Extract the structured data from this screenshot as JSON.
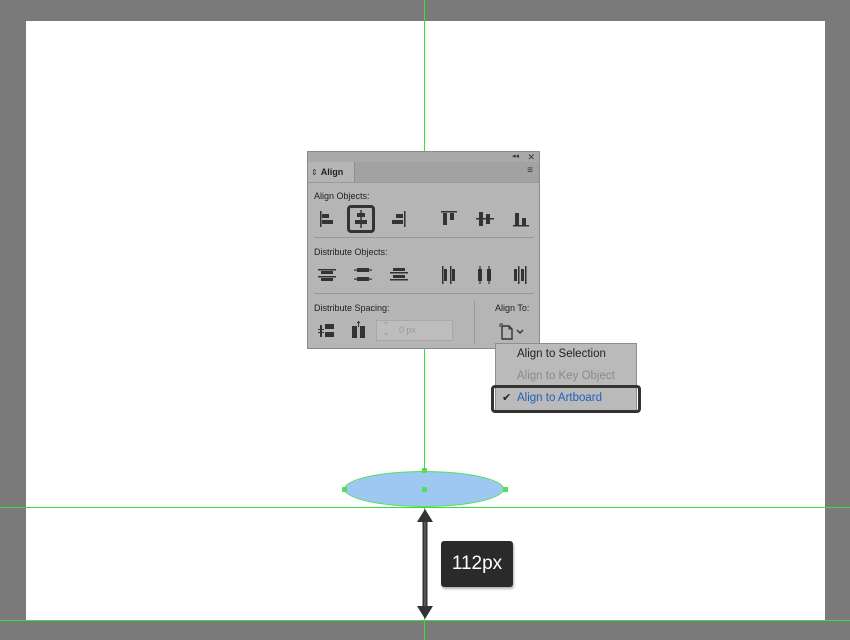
{
  "panel": {
    "tab_label": "Align",
    "collapse_glyph": "◂◂",
    "close_glyph": "✕",
    "menu_glyph": "≡",
    "tab_arrows": "⇕",
    "align_objects_label": "Align Objects:",
    "distribute_objects_label": "Distribute Objects:",
    "distribute_spacing_label": "Distribute Spacing:",
    "align_to_label": "Align To:",
    "spacing_value": "0 px",
    "highlighted_button": "horizontal-align-center"
  },
  "dropdown": {
    "items": [
      {
        "label": "Align to Selection",
        "state": "enabled"
      },
      {
        "label": "Align to Key Object",
        "state": "disabled"
      },
      {
        "label": "Align to Artboard",
        "state": "selected"
      }
    ],
    "check_glyph": "✔"
  },
  "measurement": {
    "label": "112px"
  },
  "colors": {
    "canvas_bg": "#7a7a7a",
    "artboard": "#ffffff",
    "guide": "#3ddc3d",
    "ellipse_fill": "#9ec7f2",
    "selected_item": "#1f5fbf",
    "disabled_item": "#8a8a8a"
  }
}
